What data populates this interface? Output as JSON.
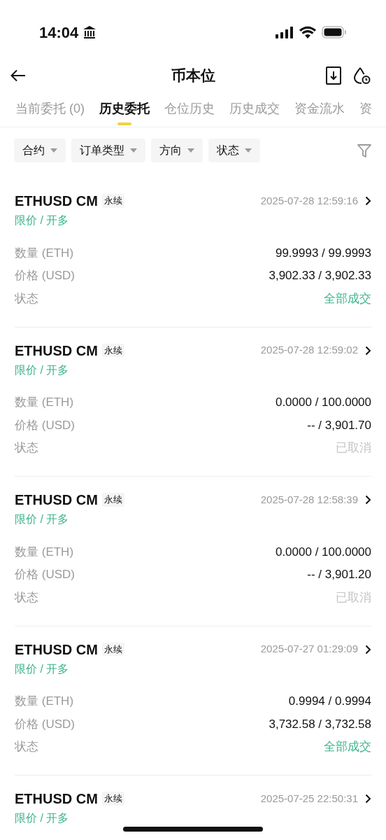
{
  "status_bar": {
    "time": "14:04"
  },
  "header": {
    "title": "币本位"
  },
  "tabs": [
    {
      "label": "当前委托 (0)",
      "selected": false
    },
    {
      "label": "历史委托",
      "selected": true
    },
    {
      "label": "仓位历史",
      "selected": false
    },
    {
      "label": "历史成交",
      "selected": false
    },
    {
      "label": "资金流水",
      "selected": false
    },
    {
      "label": "资",
      "selected": false
    }
  ],
  "filters": [
    "合约",
    "订单类型",
    "方向",
    "状态"
  ],
  "orders": [
    {
      "symbol": "ETHUSD CM",
      "tag": "永续",
      "time": "2025-07-28 12:59:16",
      "type": "限价 / 开多",
      "rows": [
        {
          "label": "数量 (ETH)",
          "value": "99.9993 / 99.9993"
        },
        {
          "label": "价格 (USD)",
          "value": "3,902.33 / 3,902.33"
        },
        {
          "label": "状态",
          "value": "全部成交",
          "kind": "filled"
        }
      ]
    },
    {
      "symbol": "ETHUSD CM",
      "tag": "永续",
      "time": "2025-07-28 12:59:02",
      "type": "限价 / 开多",
      "rows": [
        {
          "label": "数量 (ETH)",
          "value": "0.0000 / 100.0000"
        },
        {
          "label": "价格 (USD)",
          "value": "-- / 3,901.70"
        },
        {
          "label": "状态",
          "value": "已取消",
          "kind": "cancelled"
        }
      ]
    },
    {
      "symbol": "ETHUSD CM",
      "tag": "永续",
      "time": "2025-07-28 12:58:39",
      "type": "限价 / 开多",
      "rows": [
        {
          "label": "数量 (ETH)",
          "value": "0.0000 / 100.0000"
        },
        {
          "label": "价格 (USD)",
          "value": "-- / 3,901.20"
        },
        {
          "label": "状态",
          "value": "已取消",
          "kind": "cancelled"
        }
      ]
    },
    {
      "symbol": "ETHUSD CM",
      "tag": "永续",
      "time": "2025-07-27 01:29:09",
      "type": "限价 / 开多",
      "rows": [
        {
          "label": "数量 (ETH)",
          "value": "0.9994 / 0.9994"
        },
        {
          "label": "价格 (USD)",
          "value": "3,732.58 / 3,732.58"
        },
        {
          "label": "状态",
          "value": "全部成交",
          "kind": "filled"
        }
      ]
    },
    {
      "symbol": "ETHUSD CM",
      "tag": "永续",
      "time": "2025-07-25 22:50:31",
      "type": "限价 / 开多"
    }
  ]
}
